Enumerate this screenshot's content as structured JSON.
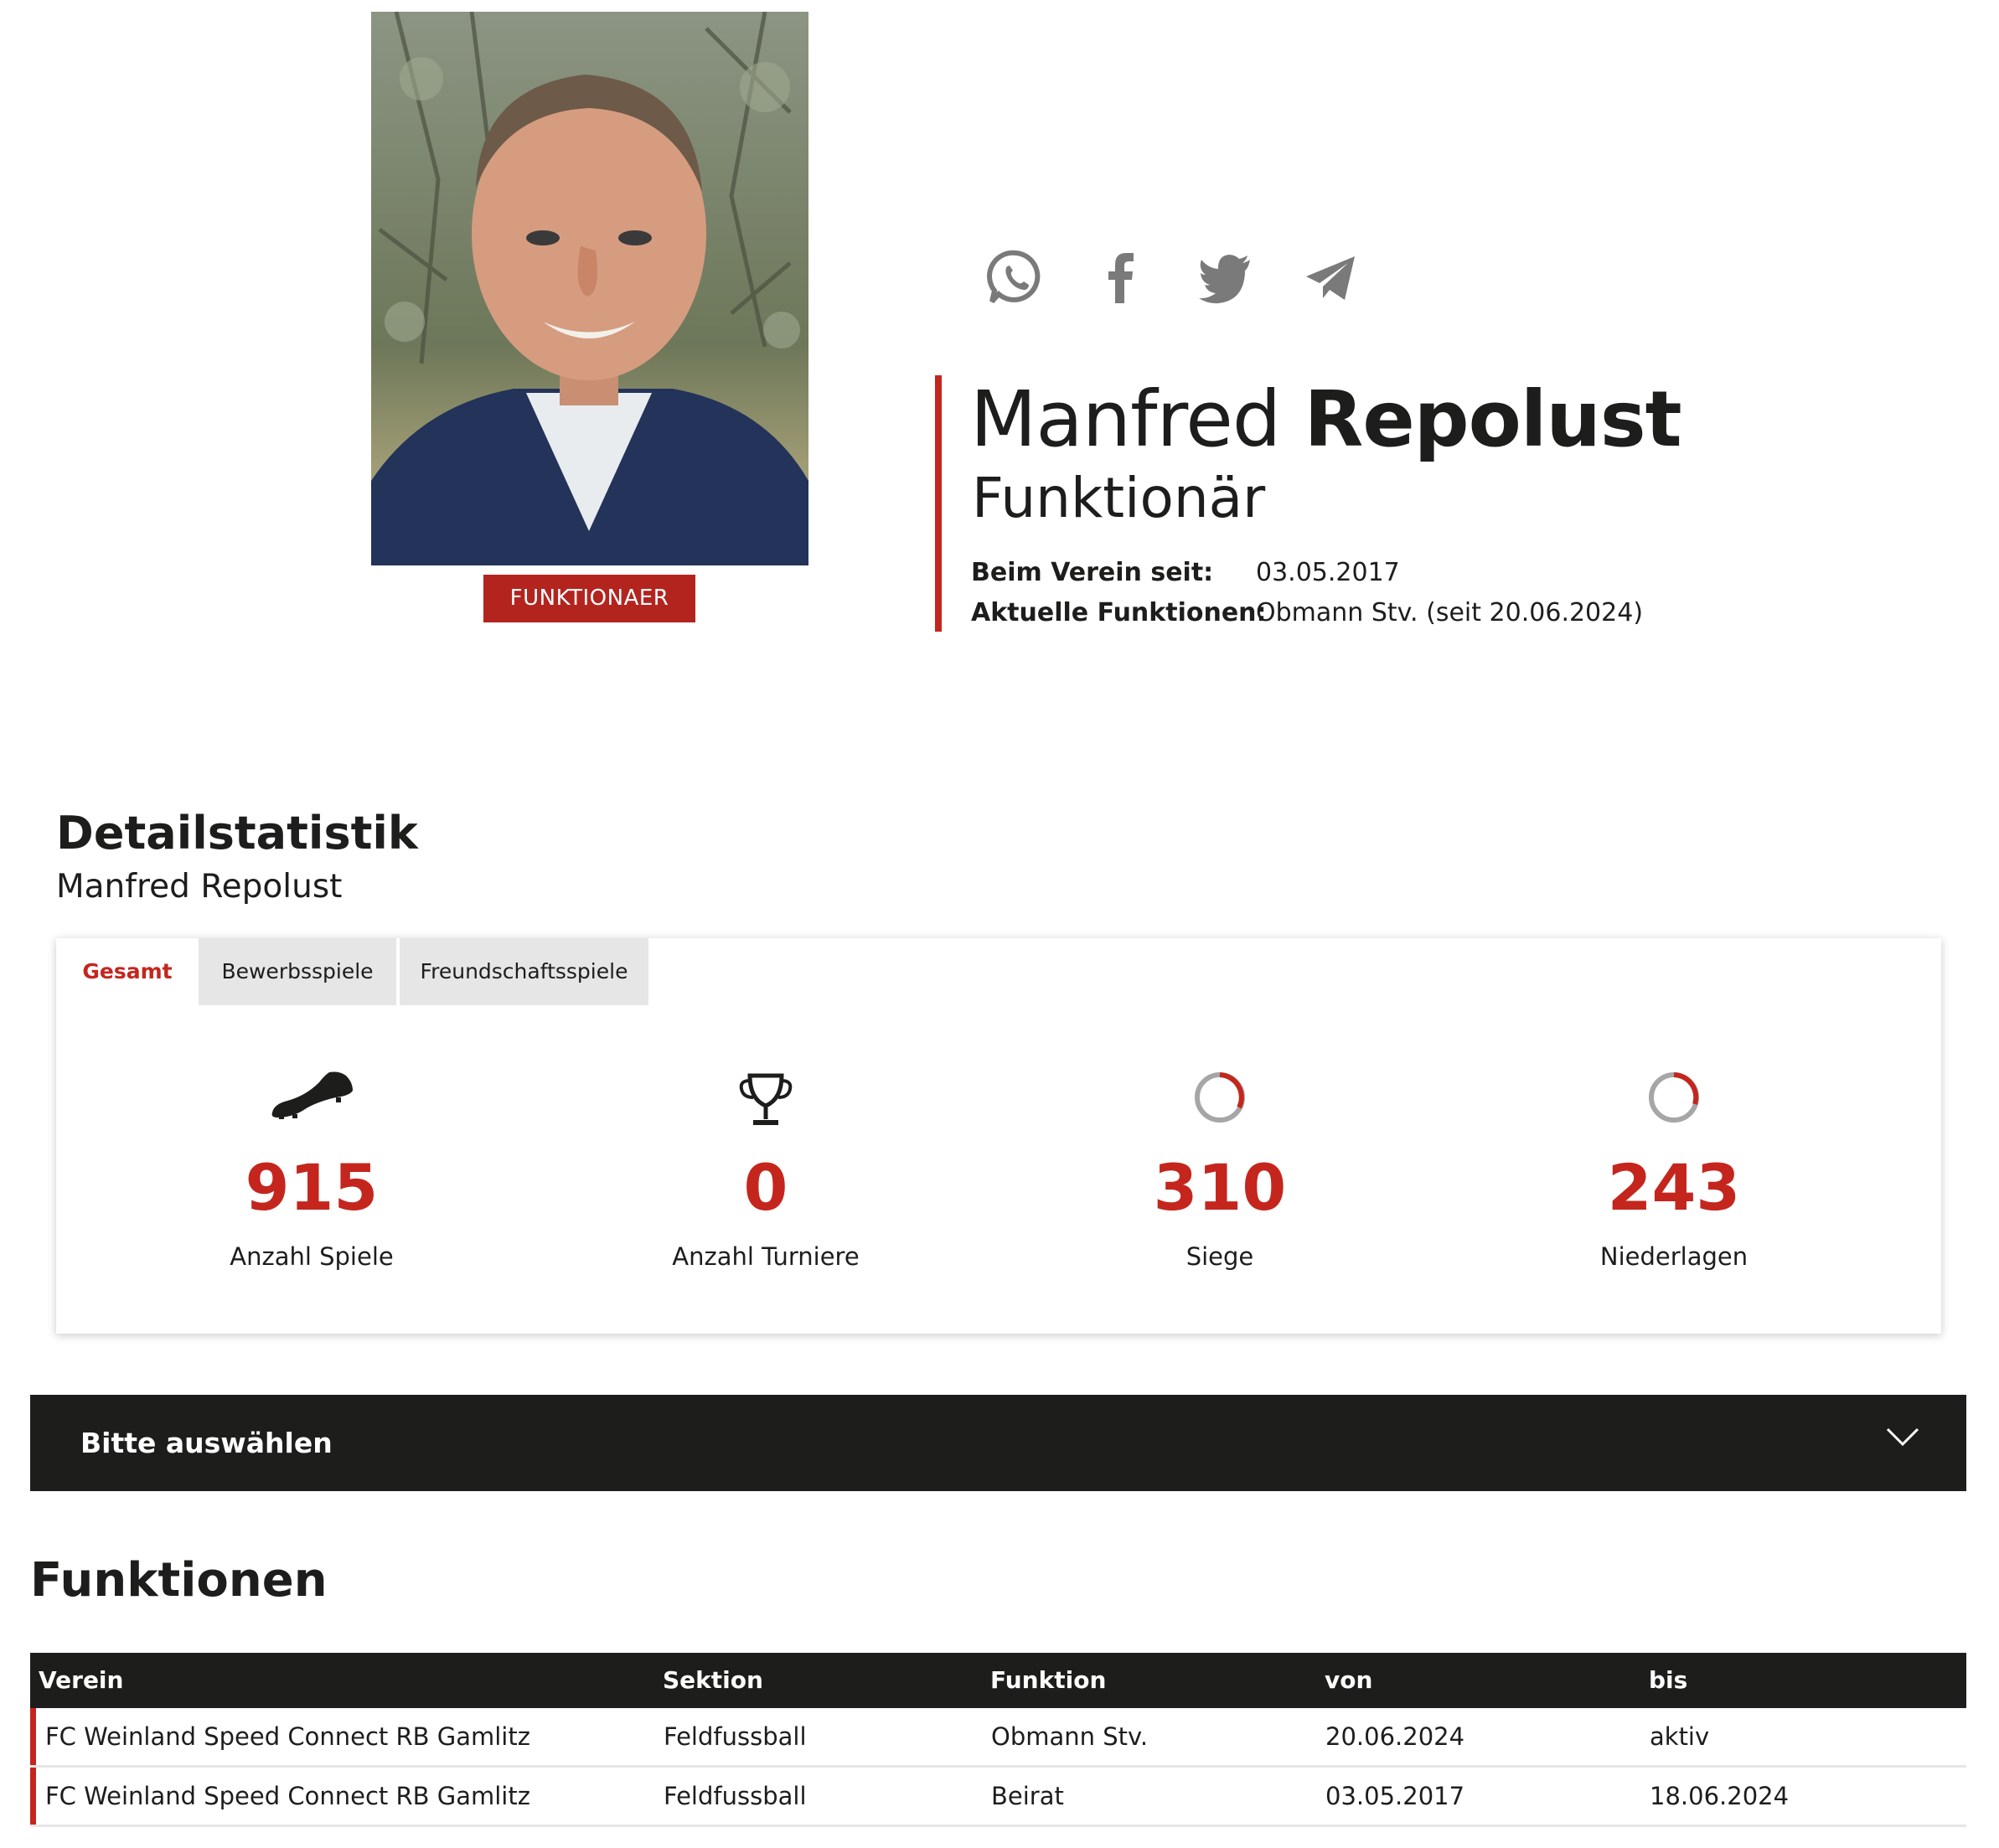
{
  "profile": {
    "first_name": "Manfred",
    "last_name": "Repolust",
    "role": "Funktionär",
    "badge": "FUNKTIONAER",
    "info": [
      {
        "label": "Beim Verein seit:",
        "value": "03.05.2017"
      },
      {
        "label": "Aktuelle Funktionen:",
        "value": "Obmann Stv. (seit 20.06.2024)"
      }
    ]
  },
  "share": [
    "whatsapp-icon",
    "facebook-icon",
    "twitter-icon",
    "telegram-icon"
  ],
  "detail": {
    "title": "Detailstatistik",
    "subtitle": "Manfred Repolust",
    "tabs": [
      {
        "label": "Gesamt",
        "active": true
      },
      {
        "label": "Bewerbsspiele",
        "active": false
      },
      {
        "label": "Freundschaftsspiele",
        "active": false
      }
    ],
    "stats": [
      {
        "icon": "football-boot-icon",
        "value": "915",
        "label": "Anzahl Spiele"
      },
      {
        "icon": "trophy-icon",
        "value": "0",
        "label": "Anzahl Turniere"
      },
      {
        "icon": "ring-progress-icon",
        "value": "310",
        "label": "Siege"
      },
      {
        "icon": "ring-progress-icon",
        "value": "243",
        "label": "Niederlagen"
      }
    ]
  },
  "select": {
    "label": "Bitte auswählen"
  },
  "functions": {
    "title": "Funktionen",
    "columns": [
      "Verein",
      "Sektion",
      "Funktion",
      "von",
      "bis"
    ],
    "rows": [
      [
        "FC Weinland Speed Connect RB Gamlitz",
        "Feldfussball",
        "Obmann Stv.",
        "20.06.2024",
        "aktiv"
      ],
      [
        "FC Weinland Speed Connect RB Gamlitz",
        "Feldfussball",
        "Beirat",
        "03.05.2017",
        "18.06.2024"
      ]
    ]
  },
  "colors": {
    "accent": "#c4261d",
    "dark": "#1d1d1b",
    "tab_inactive": "#e6e6e6",
    "icon_gray": "#7a7a7a"
  }
}
